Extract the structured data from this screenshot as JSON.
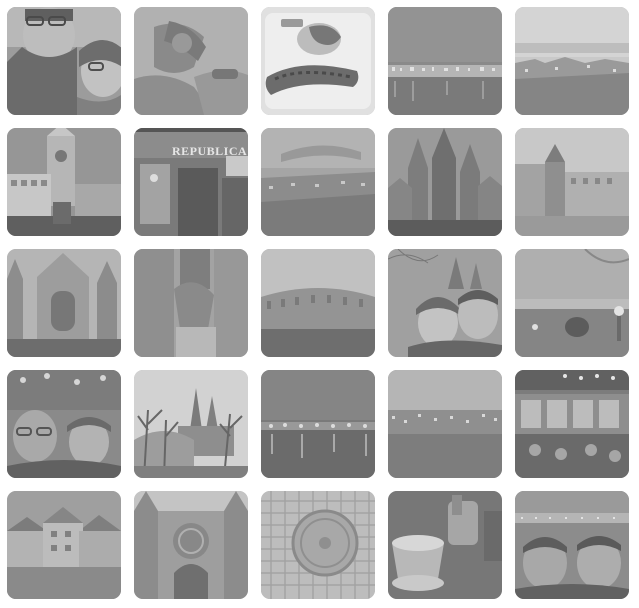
{
  "gallery": {
    "tile_overlay_opacity": 0.45,
    "tiles": [
      {
        "label": "selfie-couple-glasses-icon",
        "bg": "#8e8e8e"
      },
      {
        "label": "hands-gloves-icon",
        "bg": "#a0a0a0"
      },
      {
        "label": "food-plate-sausage-icon",
        "bg": "#c9c9c9"
      },
      {
        "label": "night-city-river-icon",
        "bg": "#9a9a9a"
      },
      {
        "label": "dusk-city-panorama-icon",
        "bg": "#b3b3b3"
      },
      {
        "label": "clock-tower-icon",
        "bg": "#8f8f8f"
      },
      {
        "label": "restaurant-entrance-icon",
        "bg": "#7f7f7f"
      },
      {
        "label": "city-view-icon",
        "bg": "#a5a5a5"
      },
      {
        "label": "cathedral-icon",
        "bg": "#8b8b8b"
      },
      {
        "label": "square-church-icon",
        "bg": "#b1b1b1"
      },
      {
        "label": "gothic-facade-icon",
        "bg": "#a2a2a2"
      },
      {
        "label": "statue-building-icon",
        "bg": "#9d9d9d"
      },
      {
        "label": "palace-courtyard-icon",
        "bg": "#a7a7a7"
      },
      {
        "label": "couple-castle-selfie-icon",
        "bg": "#8d8d8d"
      },
      {
        "label": "barrel-viewpoint-icon",
        "bg": "#9b9b9b"
      },
      {
        "label": "selfie-market-icon",
        "bg": "#838383"
      },
      {
        "label": "castle-trees-icon",
        "bg": "#a9a9a9"
      },
      {
        "label": "bridge-night-icon",
        "bg": "#858585"
      },
      {
        "label": "riverside-dusk-icon",
        "bg": "#a3a3a3"
      },
      {
        "label": "christmas-market-icon",
        "bg": "#808080"
      },
      {
        "label": "rooftops-icon",
        "bg": "#9f9f9f"
      },
      {
        "label": "rose-window-facade-icon",
        "bg": "#949494"
      },
      {
        "label": "manhole-cobblestone-icon",
        "bg": "#b7b7b7"
      },
      {
        "label": "mulled-wine-cup-icon",
        "bg": "#7d7d7d"
      },
      {
        "label": "selfie-river-icon",
        "bg": "#8a8a8a"
      }
    ]
  },
  "restaurant_sign": "REPUBLICA"
}
